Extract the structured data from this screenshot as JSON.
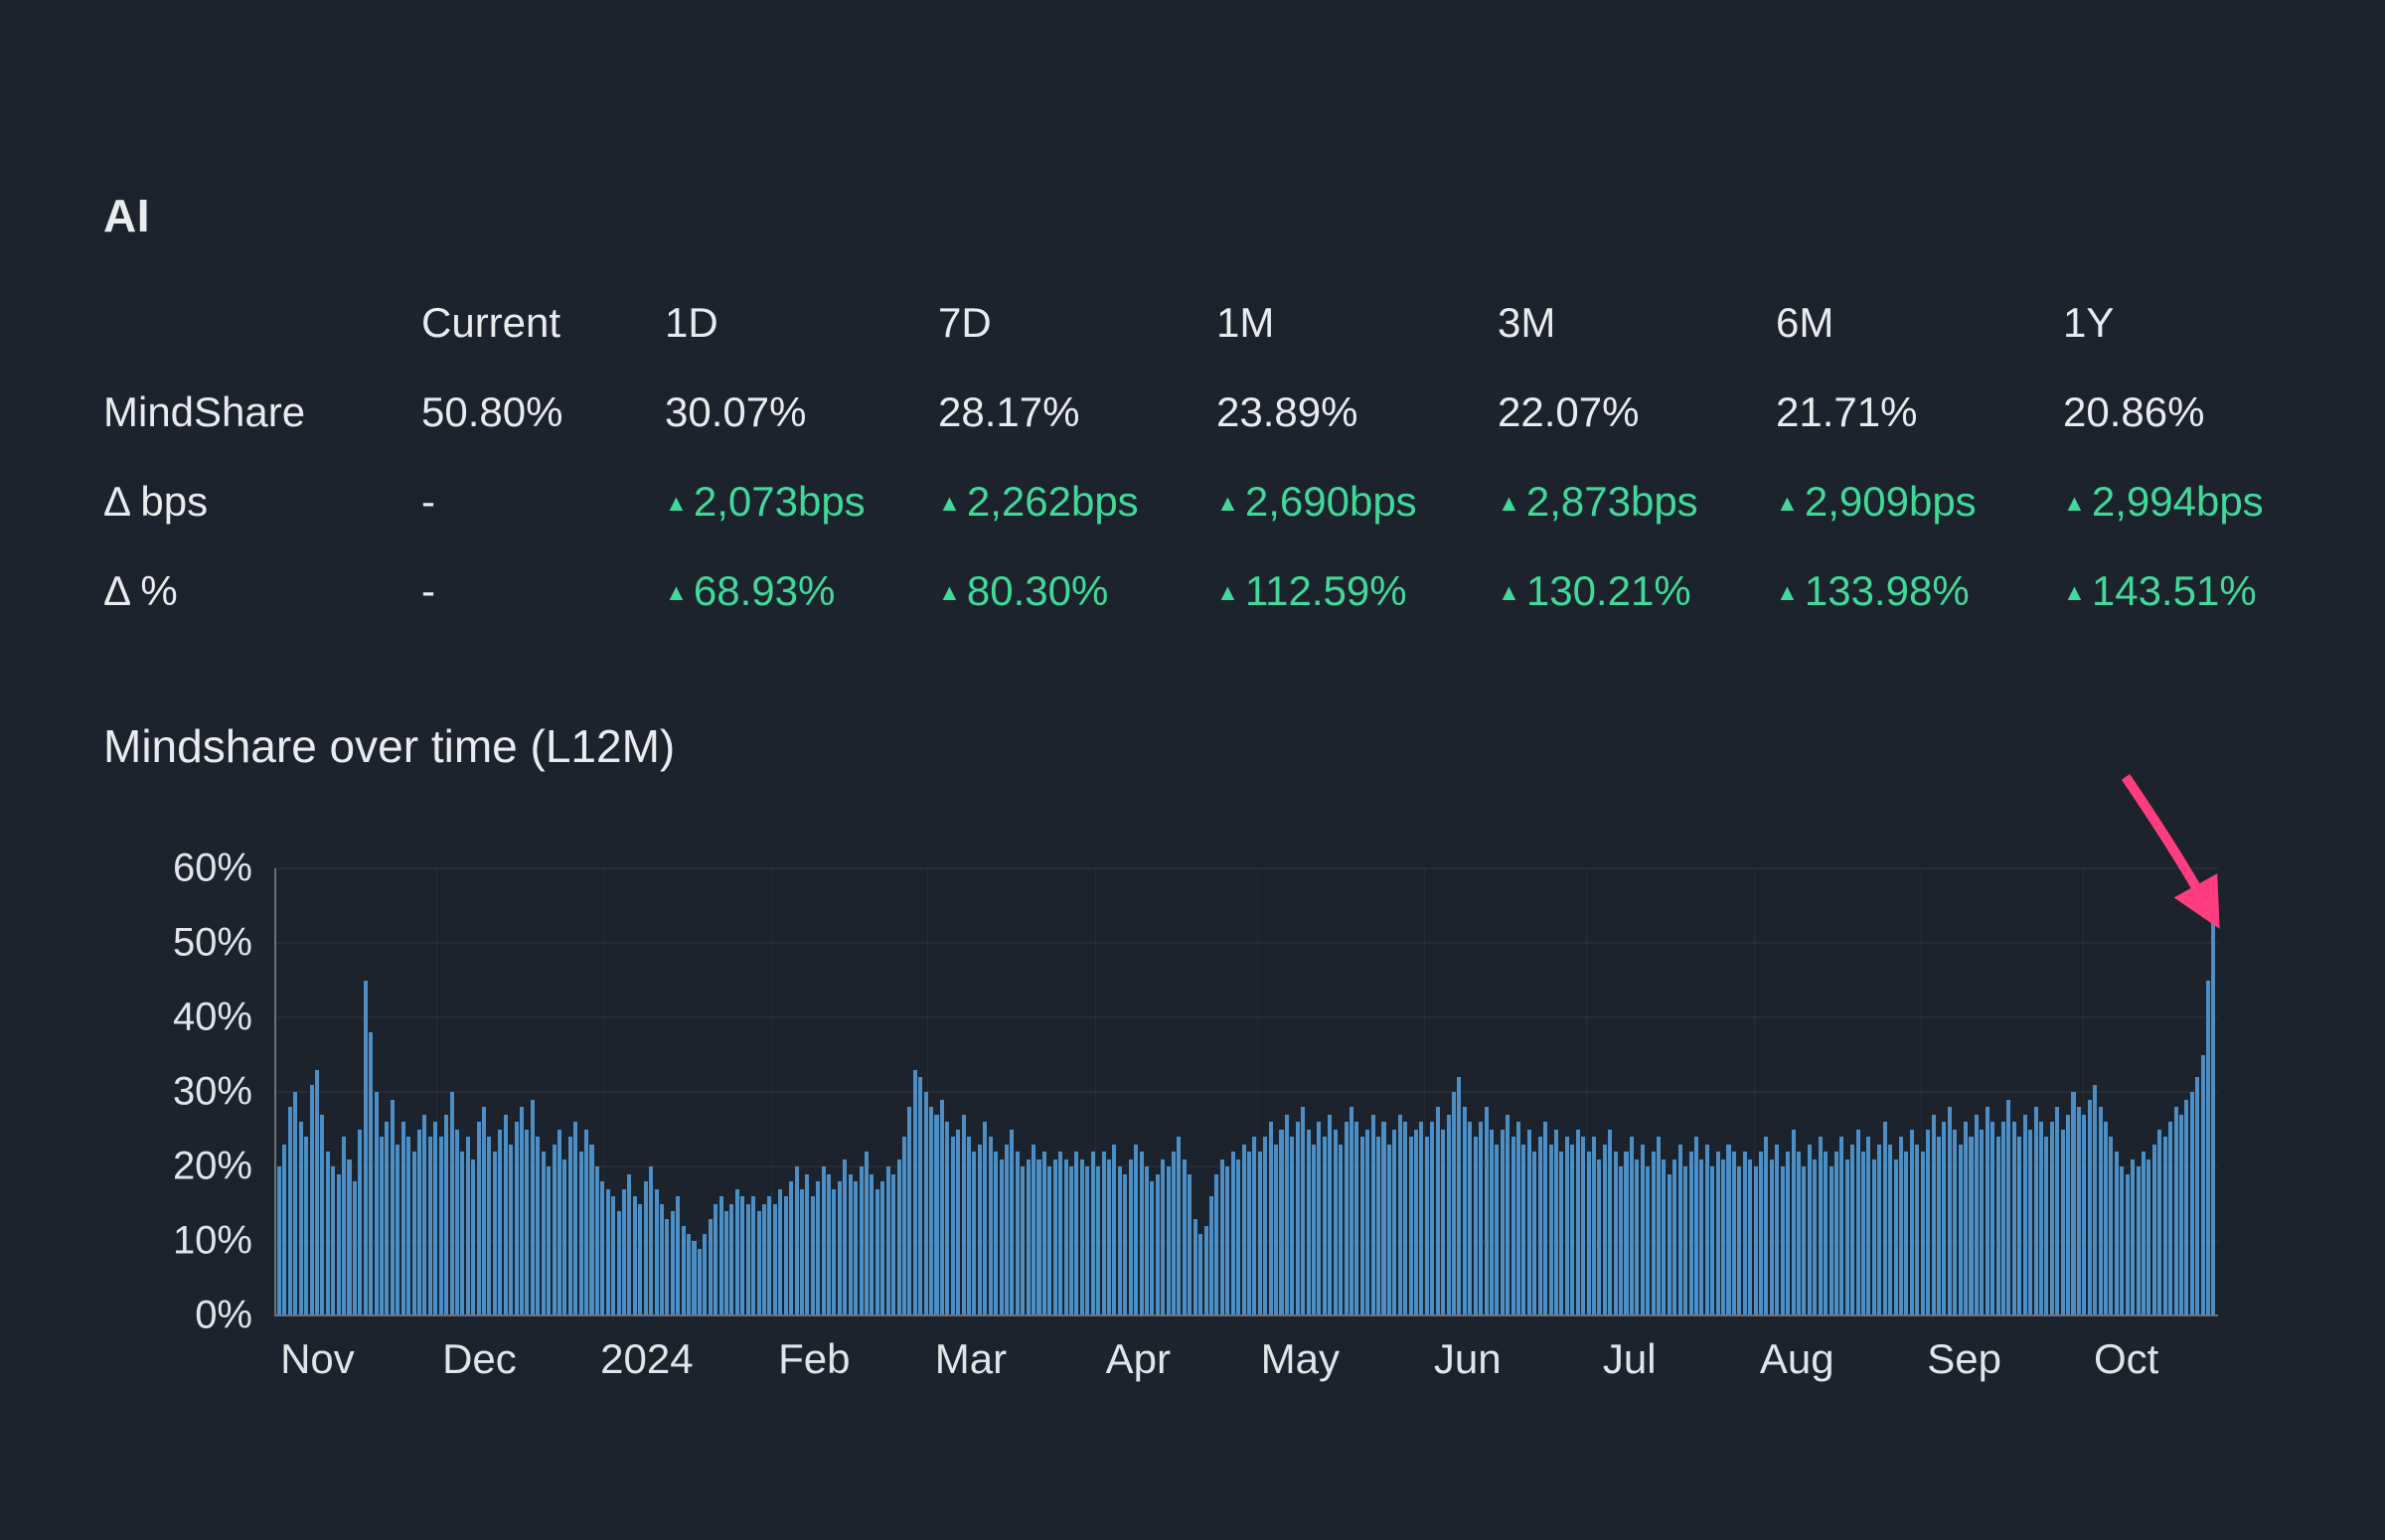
{
  "title": "AI",
  "table": {
    "headers": [
      "",
      "Current",
      "1D",
      "7D",
      "1M",
      "3M",
      "6M",
      "1Y"
    ],
    "rows": [
      {
        "label": "MindShare",
        "values": [
          "50.80%",
          "30.07%",
          "28.17%",
          "23.89%",
          "22.07%",
          "21.71%",
          "20.86%"
        ]
      },
      {
        "label": "Δ bps",
        "values": [
          "-",
          "2,073bps",
          "2,262bps",
          "2,690bps",
          "2,873bps",
          "2,909bps",
          "2,994bps"
        ]
      },
      {
        "label": "Δ %",
        "values": [
          "-",
          "68.93%",
          "80.30%",
          "112.59%",
          "130.21%",
          "133.98%",
          "143.51%"
        ]
      }
    ]
  },
  "section_title": "Mindshare over time (L12M)",
  "colors": {
    "background": "#1d232c",
    "positive": "#41d99a",
    "bar": "#4b8fc6",
    "arrow": "#ff3d7f"
  },
  "chart_data": {
    "type": "bar",
    "title": "Mindshare over time (L12M)",
    "xlabel": "",
    "ylabel": "",
    "unit": "%",
    "ylim": [
      0,
      60
    ],
    "grid": "horizontal-faint",
    "y_ticks": [
      "0%",
      "10%",
      "20%",
      "30%",
      "40%",
      "50%",
      "60%"
    ],
    "x_tick_labels": [
      "Nov",
      "Dec",
      "2024",
      "Feb",
      "Mar",
      "Apr",
      "May",
      "Jun",
      "Jul",
      "Aug",
      "Sep",
      "Oct"
    ],
    "months": [
      {
        "label": "Nov",
        "days": 30
      },
      {
        "label": "Dec",
        "days": 31
      },
      {
        "label": "2024",
        "days": 31
      },
      {
        "label": "Feb",
        "days": 29
      },
      {
        "label": "Mar",
        "days": 31
      },
      {
        "label": "Apr",
        "days": 30
      },
      {
        "label": "May",
        "days": 31
      },
      {
        "label": "Jun",
        "days": 30
      },
      {
        "label": "Jul",
        "days": 31
      },
      {
        "label": "Aug",
        "days": 31
      },
      {
        "label": "Sep",
        "days": 30
      },
      {
        "label": "Oct",
        "days": 25
      }
    ],
    "label_day_offset": 8,
    "values": [
      20,
      23,
      28,
      30,
      26,
      24,
      31,
      33,
      27,
      22,
      20,
      19,
      24,
      21,
      18,
      25,
      45,
      38,
      30,
      24,
      26,
      29,
      23,
      26,
      24,
      22,
      25,
      27,
      24,
      26,
      24,
      27,
      30,
      25,
      22,
      24,
      21,
      26,
      28,
      24,
      22,
      25,
      27,
      23,
      26,
      28,
      25,
      29,
      24,
      22,
      20,
      23,
      25,
      21,
      24,
      26,
      22,
      25,
      23,
      20,
      18,
      17,
      16,
      14,
      17,
      19,
      16,
      15,
      18,
      20,
      17,
      15,
      13,
      14,
      16,
      12,
      11,
      10,
      9,
      11,
      13,
      15,
      16,
      14,
      15,
      17,
      16,
      15,
      16,
      14,
      15,
      16,
      15,
      17,
      16,
      18,
      20,
      17,
      19,
      16,
      18,
      20,
      19,
      17,
      18,
      21,
      19,
      18,
      20,
      22,
      19,
      17,
      18,
      20,
      19,
      21,
      24,
      28,
      33,
      32,
      30,
      28,
      27,
      29,
      26,
      24,
      25,
      27,
      24,
      22,
      23,
      26,
      24,
      22,
      21,
      23,
      25,
      22,
      20,
      21,
      23,
      21,
      22,
      20,
      21,
      22,
      21,
      20,
      22,
      21,
      20,
      22,
      20,
      22,
      21,
      23,
      20,
      19,
      21,
      23,
      22,
      20,
      18,
      19,
      21,
      20,
      22,
      24,
      21,
      19,
      13,
      11,
      12,
      16,
      19,
      21,
      20,
      22,
      21,
      23,
      22,
      24,
      22,
      24,
      26,
      23,
      25,
      27,
      24,
      26,
      28,
      25,
      23,
      26,
      24,
      27,
      25,
      23,
      26,
      28,
      26,
      24,
      25,
      27,
      24,
      26,
      23,
      25,
      27,
      26,
      24,
      25,
      26,
      24,
      26,
      28,
      25,
      27,
      30,
      32,
      28,
      26,
      24,
      26,
      28,
      25,
      23,
      25,
      27,
      24,
      26,
      23,
      25,
      22,
      24,
      26,
      23,
      25,
      22,
      24,
      23,
      25,
      24,
      22,
      24,
      21,
      23,
      25,
      22,
      20,
      22,
      24,
      21,
      23,
      20,
      22,
      24,
      21,
      19,
      21,
      23,
      20,
      22,
      24,
      21,
      23,
      20,
      22,
      21,
      23,
      22,
      20,
      22,
      21,
      20,
      22,
      24,
      21,
      23,
      20,
      22,
      25,
      22,
      20,
      23,
      21,
      24,
      22,
      20,
      22,
      24,
      21,
      23,
      25,
      22,
      24,
      21,
      23,
      26,
      23,
      21,
      24,
      22,
      25,
      23,
      22,
      25,
      27,
      24,
      26,
      28,
      25,
      23,
      26,
      24,
      27,
      25,
      28,
      26,
      24,
      26,
      29,
      26,
      24,
      27,
      25,
      28,
      26,
      24,
      26,
      28,
      25,
      27,
      30,
      28,
      27,
      29,
      31,
      28,
      26,
      24,
      22,
      20,
      19,
      21,
      20,
      22,
      21,
      23,
      25,
      24,
      26,
      28,
      27,
      29,
      30,
      32,
      35,
      45,
      55
    ],
    "annotation": {
      "type": "arrow",
      "points_to": "last-bar",
      "color": "#ff3d7f"
    }
  }
}
